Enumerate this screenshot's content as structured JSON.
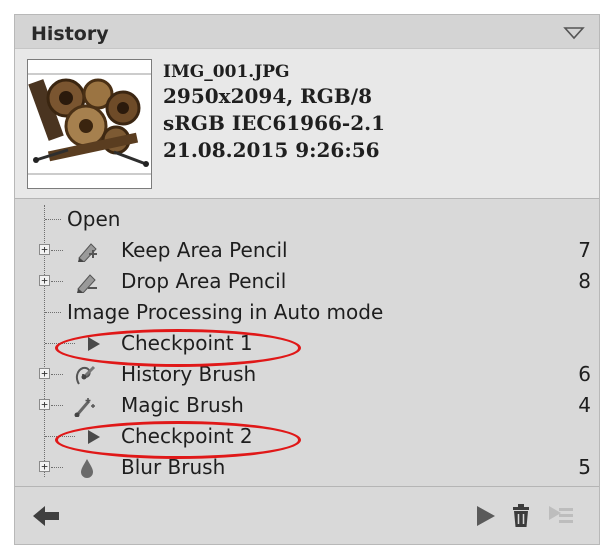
{
  "panel": {
    "title": "History",
    "menu_icon": "triangle-down-icon"
  },
  "file_info": {
    "filename": "IMG_001.JPG",
    "dimensions": "2950x2094, RGB/8",
    "color_profile": "sRGB IEC61966-2.1",
    "datetime": "21.08.2015 9:26:56"
  },
  "history": [
    {
      "label": "Open",
      "count": "",
      "icon": "none",
      "expandable": false
    },
    {
      "label": "Keep Area Pencil",
      "count": "7",
      "icon": "keep-pencil-icon",
      "expandable": true
    },
    {
      "label": "Drop Area Pencil",
      "count": "8",
      "icon": "drop-pencil-icon",
      "expandable": true
    },
    {
      "label": "Image Processing in Auto mode",
      "count": "",
      "icon": "none",
      "expandable": false
    },
    {
      "label": "Checkpoint 1",
      "count": "",
      "icon": "flag-icon",
      "expandable": false
    },
    {
      "label": "History Brush",
      "count": "6",
      "icon": "history-brush-icon",
      "expandable": true
    },
    {
      "label": "Magic Brush",
      "count": "4",
      "icon": "magic-brush-icon",
      "expandable": true
    },
    {
      "label": "Checkpoint 2",
      "count": "",
      "icon": "flag-icon",
      "expandable": false
    },
    {
      "label": "Blur Brush",
      "count": "5",
      "icon": "drop-icon",
      "expandable": true
    }
  ],
  "footer": {
    "icons": [
      "back-arrow-icon",
      "flag-icon",
      "trash-icon",
      "checkpoint-disabled-icon"
    ]
  },
  "colors": {
    "panel_bg": "#d9d9d9",
    "highlight_ellipse": "#e01818"
  }
}
